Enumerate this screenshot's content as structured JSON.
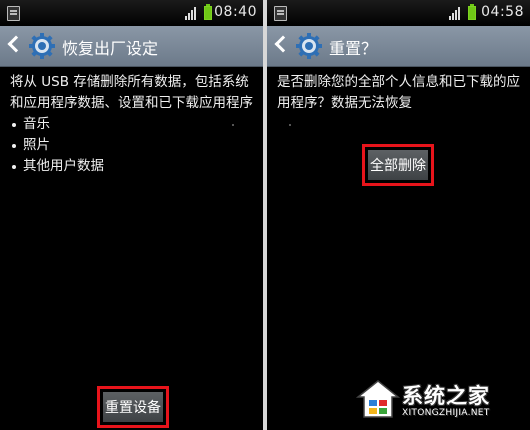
{
  "left_screen": {
    "status_time": "08:40",
    "title": "恢复出厂设定",
    "description": "将从 USB 存储删除所有数据，包括系统和应用程序数据、设置和已下载应用程序",
    "items": [
      {
        "label": "音乐"
      },
      {
        "label": "照片"
      },
      {
        "label": "其他用户数据"
      }
    ],
    "reset_button_label": "重置设备"
  },
  "right_screen": {
    "status_time": "04:58",
    "title": "重置？",
    "description": "是否删除您的全部个人信息和已下载的应用程序？数据无法恢复",
    "delete_button_label": "全部删除"
  },
  "watermark": {
    "title": "系统之家",
    "url": "XITONGZHIJIA.NET"
  },
  "colors": {
    "highlight": "#e8141b",
    "action_bar": "#7d8a99",
    "battery": "#6fc716",
    "background": "#000000"
  }
}
